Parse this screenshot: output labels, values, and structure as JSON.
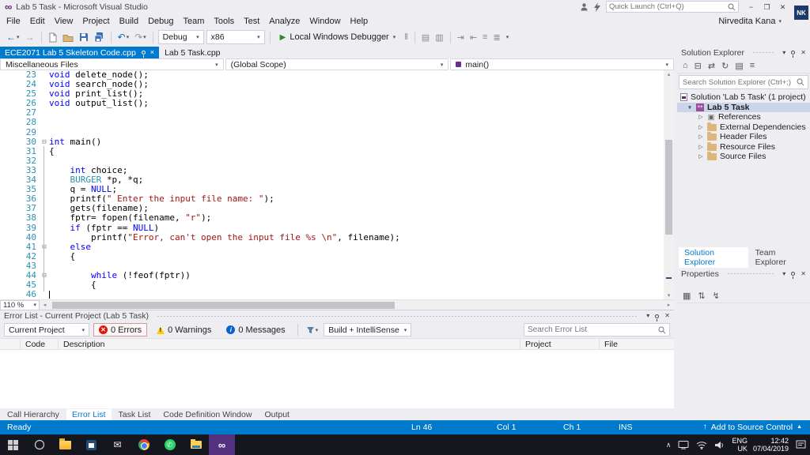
{
  "title_bar": {
    "title": "Lab 5 Task - Microsoft Visual Studio",
    "quick_launch_placeholder": "Quick Launch (Ctrl+Q)",
    "user_badge": "NK",
    "window_buttons": {
      "minimize": "−",
      "maximize": "❐",
      "close": "✕"
    }
  },
  "menu": {
    "items": [
      "File",
      "Edit",
      "View",
      "Project",
      "Build",
      "Debug",
      "Team",
      "Tools",
      "Test",
      "Analyze",
      "Window",
      "Help"
    ],
    "user_name": "Nirvedita Kana"
  },
  "toolbar": {
    "config": "Debug",
    "platform": "x86",
    "run_label": "Local Windows Debugger"
  },
  "tabs": [
    {
      "label": "ECE2071 Lab 5 Skeleton Code.cpp",
      "active": true
    },
    {
      "label": "Lab 5 Task.cpp",
      "active": false
    }
  ],
  "navbar": {
    "project": "Miscellaneous Files",
    "scope": "(Global Scope)",
    "member": "main()"
  },
  "editor": {
    "zoom_level": "110 %",
    "lines": [
      {
        "n": 23,
        "tokens": [
          [
            "kw",
            "void"
          ],
          [
            "pl",
            " delete_node();"
          ]
        ]
      },
      {
        "n": 24,
        "tokens": [
          [
            "kw",
            "void"
          ],
          [
            "pl",
            " search_node();"
          ]
        ]
      },
      {
        "n": 25,
        "tokens": [
          [
            "kw",
            "void"
          ],
          [
            "pl",
            " print_list();"
          ]
        ]
      },
      {
        "n": 26,
        "tokens": [
          [
            "kw",
            "void"
          ],
          [
            "pl",
            " output_list();"
          ]
        ]
      },
      {
        "n": 27,
        "tokens": []
      },
      {
        "n": 28,
        "tokens": []
      },
      {
        "n": 29,
        "tokens": []
      },
      {
        "n": 30,
        "fold": true,
        "tokens": [
          [
            "kw",
            "int"
          ],
          [
            "pl",
            " main()"
          ]
        ]
      },
      {
        "n": 31,
        "tokens": [
          [
            "pl",
            "{"
          ]
        ]
      },
      {
        "n": 32,
        "tokens": []
      },
      {
        "n": 33,
        "tokens": [
          [
            "pl",
            "    "
          ],
          [
            "kw",
            "int"
          ],
          [
            "pl",
            " choice;"
          ]
        ]
      },
      {
        "n": 34,
        "tokens": [
          [
            "pl",
            "    "
          ],
          [
            "ty",
            "BURGER"
          ],
          [
            "pl",
            " *p, *q;"
          ]
        ]
      },
      {
        "n": 35,
        "tokens": [
          [
            "pl",
            "    q = "
          ],
          [
            "kw",
            "NULL"
          ],
          [
            "pl",
            ";"
          ]
        ]
      },
      {
        "n": 36,
        "tokens": [
          [
            "pl",
            "    printf("
          ],
          [
            "str",
            "\" Enter the input file name: \""
          ],
          [
            "pl",
            ");"
          ]
        ]
      },
      {
        "n": 37,
        "tokens": [
          [
            "pl",
            "    gets(filename);"
          ]
        ]
      },
      {
        "n": 38,
        "tokens": [
          [
            "pl",
            "    fptr= fopen(filename, "
          ],
          [
            "str",
            "\"r\""
          ],
          [
            "pl",
            ");"
          ]
        ]
      },
      {
        "n": 39,
        "tokens": [
          [
            "pl",
            "    "
          ],
          [
            "kw",
            "if"
          ],
          [
            "pl",
            " (fptr == "
          ],
          [
            "kw",
            "NULL"
          ],
          [
            "pl",
            ")"
          ]
        ]
      },
      {
        "n": 40,
        "tokens": [
          [
            "pl",
            "        printf("
          ],
          [
            "str",
            "\"Error, can't open the input file %s \\n\""
          ],
          [
            "pl",
            ", filename);"
          ]
        ]
      },
      {
        "n": 41,
        "fold": true,
        "tokens": [
          [
            "pl",
            "    "
          ],
          [
            "kw",
            "else"
          ]
        ]
      },
      {
        "n": 42,
        "tokens": [
          [
            "pl",
            "    {"
          ]
        ]
      },
      {
        "n": 43,
        "tokens": []
      },
      {
        "n": 44,
        "fold": true,
        "tokens": [
          [
            "pl",
            "        "
          ],
          [
            "kw",
            "while"
          ],
          [
            "pl",
            " (!feof(fptr))"
          ]
        ]
      },
      {
        "n": 45,
        "tokens": [
          [
            "pl",
            "        {"
          ]
        ]
      },
      {
        "n": 46,
        "cursor": true,
        "tokens": []
      }
    ]
  },
  "solution_explorer": {
    "title": "Solution Explorer",
    "search_placeholder": "Search Solution Explorer (Ctrl+;)",
    "root_label": "Solution 'Lab 5 Task' (1 project)",
    "project_label": "Lab 5 Task",
    "children": [
      {
        "label": "References",
        "icon": "references"
      },
      {
        "label": "External Dependencies",
        "icon": "folder"
      },
      {
        "label": "Header Files",
        "icon": "folder"
      },
      {
        "label": "Resource Files",
        "icon": "folder"
      },
      {
        "label": "Source Files",
        "icon": "folder"
      }
    ],
    "tabs": [
      {
        "label": "Solution Explorer",
        "active": true
      },
      {
        "label": "Team Explorer",
        "active": false
      }
    ]
  },
  "properties": {
    "title": "Properties"
  },
  "error_list": {
    "title": "Error List - Current Project (Lab 5 Task)",
    "scope": "Current Project",
    "errors": "0 Errors",
    "warnings": "0 Warnings",
    "messages": "0 Messages",
    "source": "Build + IntelliSense",
    "search_placeholder": "Search Error List",
    "columns": [
      "Code",
      "Description",
      "Project",
      "File"
    ]
  },
  "panel_tabs": [
    {
      "label": "Call Hierarchy"
    },
    {
      "label": "Error List",
      "active": true
    },
    {
      "label": "Task List"
    },
    {
      "label": "Code Definition Window"
    },
    {
      "label": "Output"
    }
  ],
  "status_bar": {
    "state": "Ready",
    "line": "Ln 46",
    "column": "Col 1",
    "character": "Ch 1",
    "mode": "INS",
    "source_control": "Add to Source Control"
  },
  "taskbar": {
    "language": "ENG",
    "region": "UK",
    "time": "12:42",
    "date": "07/04/2019"
  },
  "colors": {
    "accent": "#007acc",
    "status_bar": "#007acc",
    "vs_purple": "#68217a",
    "keyword": "#0000ff",
    "string": "#a31515",
    "type": "#2b91af",
    "line_number": "#2b91af",
    "error_red": "#e51400",
    "warning_yellow": "#ffcc00"
  }
}
